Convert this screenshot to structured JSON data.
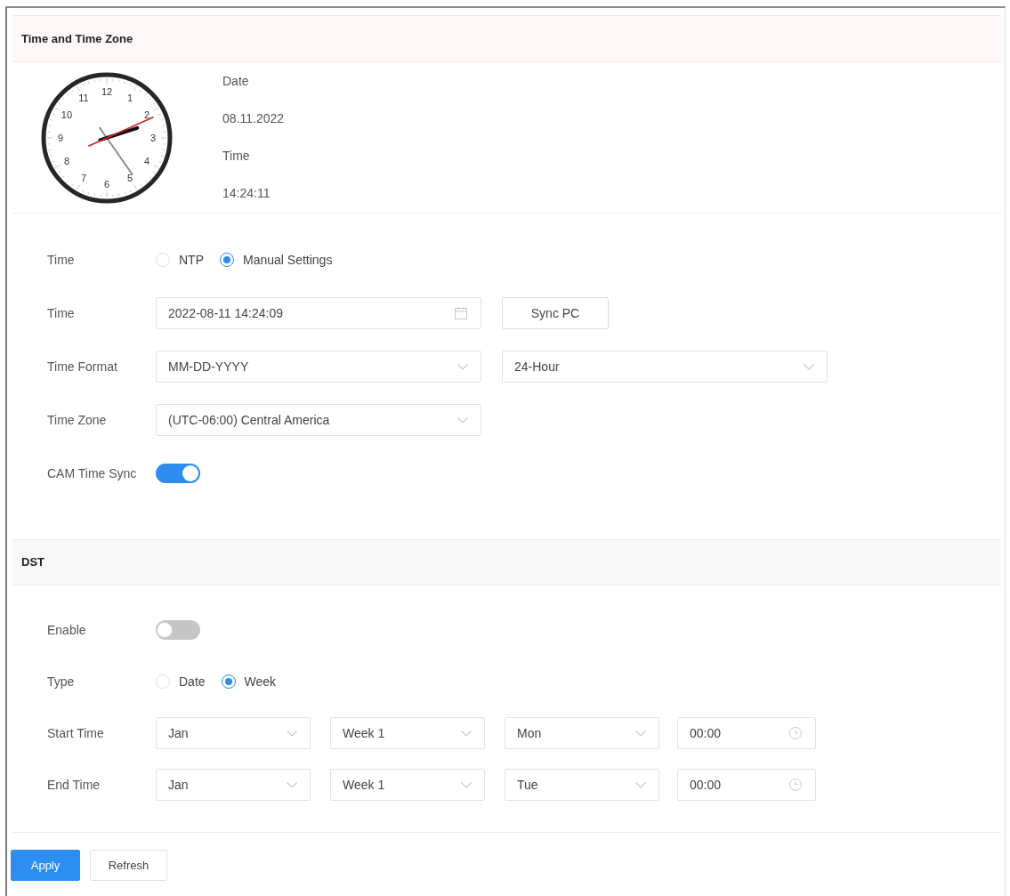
{
  "time_section": {
    "title": "Time and Time Zone",
    "clock": {
      "numerals": [
        "12",
        "1",
        "2",
        "3",
        "4",
        "5",
        "6",
        "7",
        "8",
        "9",
        "10",
        "11"
      ]
    },
    "info": [
      {
        "label": "Date",
        "value": "08.11.2022"
      },
      {
        "label": "Time",
        "value": "14:24:11"
      }
    ],
    "rows": [
      {
        "kind": "radio",
        "label": "Time",
        "options": [
          {
            "label": "NTP",
            "selected": false
          },
          {
            "label": "Manual Settings",
            "selected": true
          }
        ]
      },
      {
        "kind": "datetime",
        "label": "Time",
        "value": "2022-08-11 14:24:09",
        "button": "Sync PC"
      },
      {
        "kind": "select",
        "label": "Time Format",
        "selects": [
          "MM-DD-YYYY",
          "24-Hour"
        ]
      },
      {
        "kind": "select",
        "label": "Time Zone",
        "selects": [
          "(UTC-06:00) Central America"
        ]
      },
      {
        "kind": "toggle",
        "label": "CAM Time Sync",
        "on": true
      }
    ]
  },
  "dst_section": {
    "title": "DST",
    "rows": [
      {
        "kind": "toggle",
        "label": "Enable",
        "on": false
      },
      {
        "kind": "radio",
        "label": "Type",
        "options": [
          {
            "label": "Date",
            "selected": false
          },
          {
            "label": "Week",
            "selected": true
          }
        ]
      },
      {
        "kind": "schedule",
        "label": "Start Time",
        "selects": [
          "Jan",
          "Week 1",
          "Mon"
        ],
        "time": "00:00"
      },
      {
        "kind": "schedule",
        "label": "End Time",
        "selects": [
          "Jan",
          "Week 1",
          "Tue"
        ],
        "time": "00:00"
      }
    ]
  },
  "buttons": [
    {
      "label": "Apply",
      "kind": "primary"
    },
    {
      "label": "Refresh",
      "kind": "default"
    }
  ]
}
